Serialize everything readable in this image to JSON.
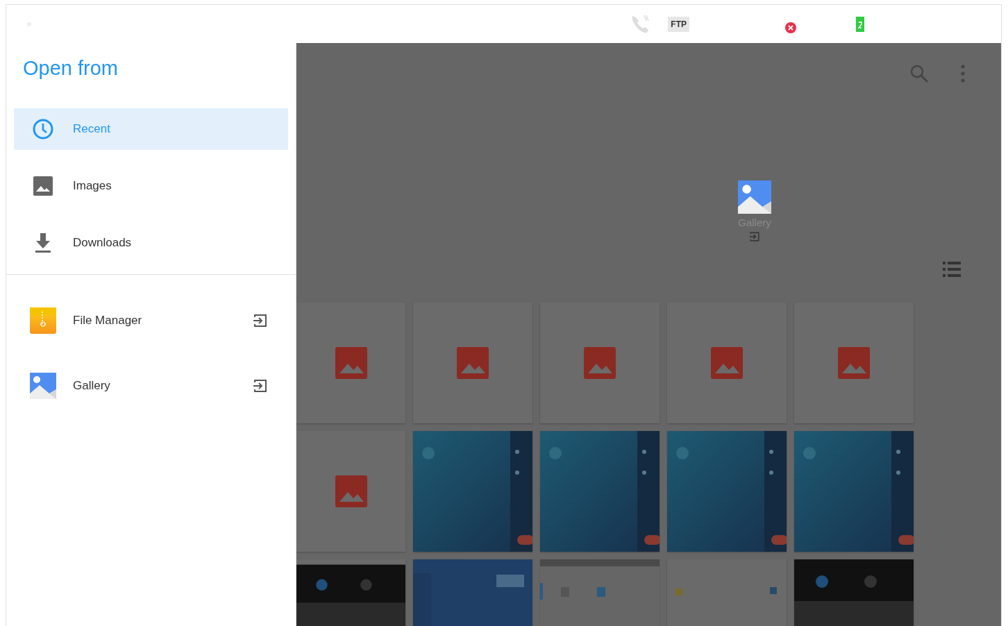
{
  "status_bar": {
    "ftp_label": "FTP"
  },
  "drawer": {
    "title": "Open from",
    "roots": [
      {
        "label": "Recent",
        "kind": "recent",
        "selected": true
      },
      {
        "label": "Images",
        "kind": "images",
        "selected": false
      },
      {
        "label": "Downloads",
        "kind": "downloads",
        "selected": false
      }
    ],
    "apps": [
      {
        "label": "File Manager",
        "kind": "file-manager"
      },
      {
        "label": "Gallery",
        "kind": "gallery"
      }
    ]
  },
  "main": {
    "gallery_shortcut": {
      "label": "Gallery"
    },
    "thumbnails": [
      {
        "kind": "placeholder"
      },
      {
        "kind": "placeholder"
      },
      {
        "kind": "placeholder"
      },
      {
        "kind": "placeholder"
      },
      {
        "kind": "placeholder"
      },
      {
        "kind": "placeholder"
      },
      {
        "kind": "picture"
      },
      {
        "kind": "picture"
      },
      {
        "kind": "picture"
      },
      {
        "kind": "picture"
      },
      {
        "kind": "picture"
      },
      {
        "kind": "picture"
      },
      {
        "kind": "picture"
      },
      {
        "kind": "picture"
      },
      {
        "kind": "picture"
      }
    ]
  }
}
